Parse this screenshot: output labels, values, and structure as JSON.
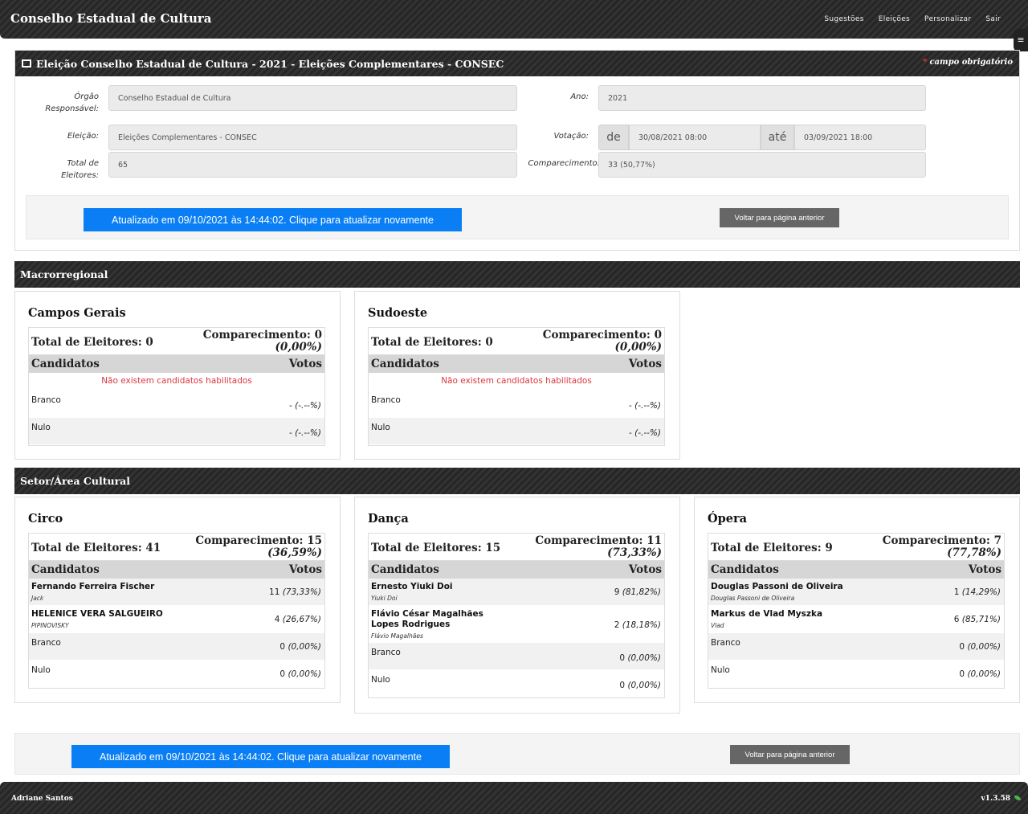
{
  "app": {
    "title": "Conselho Estadual de Cultura"
  },
  "nav": [
    "Sugestões",
    "Eleições",
    "Personalizar",
    "Sair"
  ],
  "menu_toggle": "≡",
  "header": {
    "title": "Eleição Conselho Estadual de Cultura - 2021 - Eleições Complementares - CONSEC",
    "required_star": "*",
    "required_label": "campo obrigatório"
  },
  "form": {
    "orgao_label": "Órgão Responsável:",
    "orgao_value": "Conselho Estadual de Cultura",
    "ano_label": "Ano:",
    "ano_value": "2021",
    "eleicao_label": "Eleição:",
    "eleicao_value": "Eleições Complementares - CONSEC",
    "votacao_label": "Votação:",
    "de_label": "de",
    "de_value": "30/08/2021 08:00",
    "ate_label": "até",
    "ate_value": "03/09/2021 18:00",
    "total_label": "Total de Eleitores:",
    "total_value": "65",
    "comp_label": "Comparecimento:",
    "comp_value": "33 (50,77%)"
  },
  "actions": {
    "refresh": "Atualizado em 09/10/2021 às 14:44:02. Clique para atualizar novamente",
    "back": "Voltar para página anterior"
  },
  "sections": {
    "macro": "Macrorregional",
    "setor": "Setor/Área Cultural"
  },
  "table_headers": {
    "candidatos": "Candidatos",
    "votos": "Votos"
  },
  "no_candidates": "Não existem candidatos habilitados",
  "macro_cards": [
    {
      "name": "Campos Gerais",
      "total": "Total de Eleitores: 0",
      "comp": "Comparecimento: 0",
      "comp_pct": "(0,00%)",
      "branco_label": "Branco",
      "branco_v": "-",
      "branco_p": "(-.--%)",
      "nulo_label": "Nulo",
      "nulo_v": "-",
      "nulo_p": "(-.--%)"
    },
    {
      "name": "Sudoeste",
      "total": "Total de Eleitores: 0",
      "comp": "Comparecimento: 0",
      "comp_pct": "(0,00%)",
      "branco_label": "Branco",
      "branco_v": "-",
      "branco_p": "(-.--%)",
      "nulo_label": "Nulo",
      "nulo_v": "-",
      "nulo_p": "(-.--%)"
    }
  ],
  "setor_cards": [
    {
      "name": "Circo",
      "total": "Total de Eleitores: 41",
      "comp": "Comparecimento: 15",
      "comp_pct": "(36,59%)",
      "candidates": [
        {
          "name": "Fernando Ferreira Fischer",
          "alias": "Jack",
          "votes": "11",
          "pct": "(73,33%)"
        },
        {
          "name": "HELENICE VERA SALGUEIRO",
          "alias": "PIPINOVISKY",
          "votes": "4",
          "pct": "(26,67%)"
        }
      ],
      "branco_label": "Branco",
      "branco_v": "0",
      "branco_p": "(0,00%)",
      "nulo_label": "Nulo",
      "nulo_v": "0",
      "nulo_p": "(0,00%)"
    },
    {
      "name": "Dança",
      "total": "Total de Eleitores: 15",
      "comp": "Comparecimento: 11",
      "comp_pct": "(73,33%)",
      "candidates": [
        {
          "name": "Ernesto Yiuki Doi",
          "alias": "Yiuki Doi",
          "votes": "9",
          "pct": "(81,82%)"
        },
        {
          "name": "Flávio César Magalhães Lopes Rodrigues",
          "alias": "Flávio Magalhães",
          "votes": "2",
          "pct": "(18,18%)"
        }
      ],
      "branco_label": "Branco",
      "branco_v": "0",
      "branco_p": "(0,00%)",
      "nulo_label": "Nulo",
      "nulo_v": "0",
      "nulo_p": "(0,00%)"
    },
    {
      "name": "Ópera",
      "total": "Total de Eleitores: 9",
      "comp": "Comparecimento: 7",
      "comp_pct": "(77,78%)",
      "candidates": [
        {
          "name": "Douglas Passoni de Oliveira",
          "alias": "Douglas Passoni de Oliveira",
          "votes": "1",
          "pct": "(14,29%)"
        },
        {
          "name": "Markus de Vlad Myszka",
          "alias": "Vlad",
          "votes": "6",
          "pct": "(85,71%)"
        }
      ],
      "branco_label": "Branco",
      "branco_v": "0",
      "branco_p": "(0,00%)",
      "nulo_label": "Nulo",
      "nulo_v": "0",
      "nulo_p": "(0,00%)"
    }
  ],
  "footer": {
    "user": "Adriane Santos",
    "version": "v1.3.58"
  }
}
